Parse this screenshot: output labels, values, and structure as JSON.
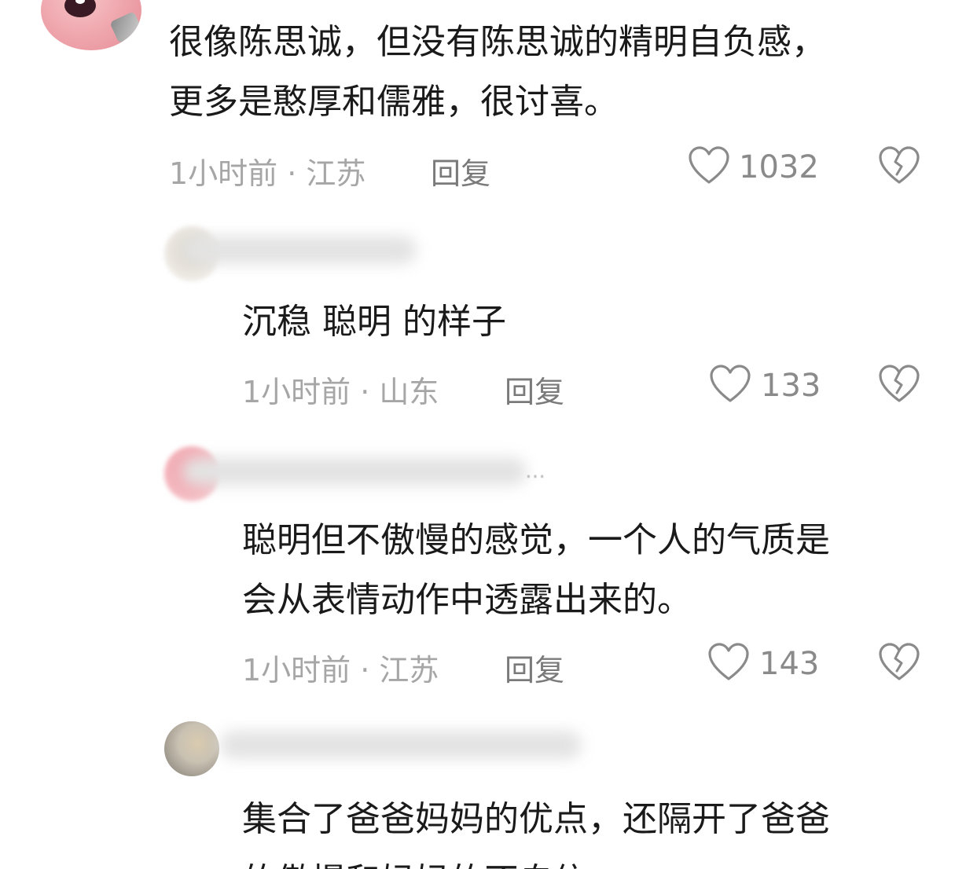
{
  "comments": [
    {
      "text": "很像陈思诚，但没有陈思诚的精明自负感，\n更多是憨厚和儒雅，很讨喜。",
      "time_location": "1小时前 · 江苏",
      "reply_label": "回复",
      "likes": "1032"
    }
  ],
  "replies": [
    {
      "text": "沉稳 聪明 的样子",
      "time_location": "1小时前 · 山东",
      "reply_label": "回复",
      "likes": "133"
    },
    {
      "name_tail": "…",
      "text": "聪明但不傲慢的感觉，一个人的气质是\n会从表情动作中透露出来的。",
      "time_location": "1小时前 · 江苏",
      "reply_label": "回复",
      "likes": "143"
    },
    {
      "text": "集合了爸爸妈妈的优点，还隔开了爸爸",
      "text_cut": "的傲慢和妈妈的不自信"
    }
  ],
  "icons": {
    "like": "heart-outline-icon",
    "dislike": "broken-heart-icon"
  },
  "colors": {
    "text": "#1a1a1a",
    "meta": "#a6a6a6",
    "reply": "#7a7a7a",
    "icon": "#8a8a8a"
  }
}
